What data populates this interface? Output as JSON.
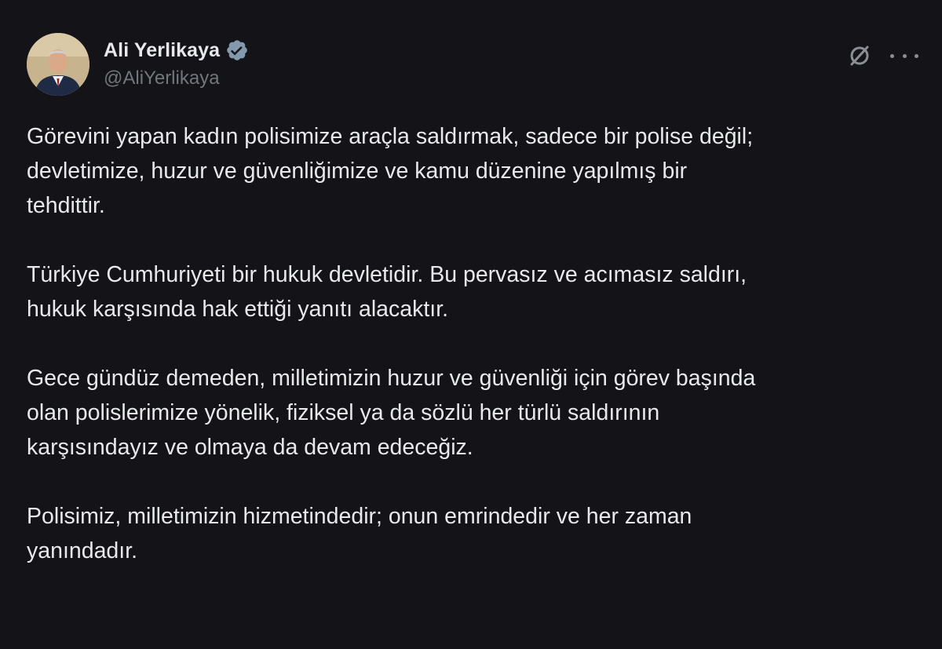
{
  "author": {
    "display_name": "Ali Yerlikaya",
    "handle": "@AliYerlikaya",
    "verified": true,
    "avatar_icon": "avatar-portrait",
    "verified_icon": "verified-badge-icon"
  },
  "actions": {
    "grok_icon": "grok-icon",
    "more_icon": "more-options-icon"
  },
  "tweet": {
    "paragraphs": [
      "Görevini yapan kadın polisimize araçla saldırmak, sadece bir polise değil;\ndevletimize, huzur ve güvenliğimize ve kamu düzenine yapılmış bir\ntehdittir.",
      "Türkiye Cumhuriyeti bir hukuk devletidir. Bu pervasız ve acımasız saldırı,\nhukuk karşısında hak ettiği yanıtı alacaktır.",
      "Gece gündüz demeden, milletimizin huzur ve güvenliği için görev başında\nolan polislerimize yönelik, fiziksel ya da sözlü her türlü saldırının\nkarşısındayız ve olmaya da devam edeceğiz.",
      "Polisimiz, milletimizin hizmetindedir; onun emrindedir ve her zaman\nyanındadır."
    ]
  },
  "colors": {
    "background": "#141318",
    "text": "#e7e9ea",
    "secondary_text": "#71767b",
    "verified_badge": "#829aab"
  }
}
